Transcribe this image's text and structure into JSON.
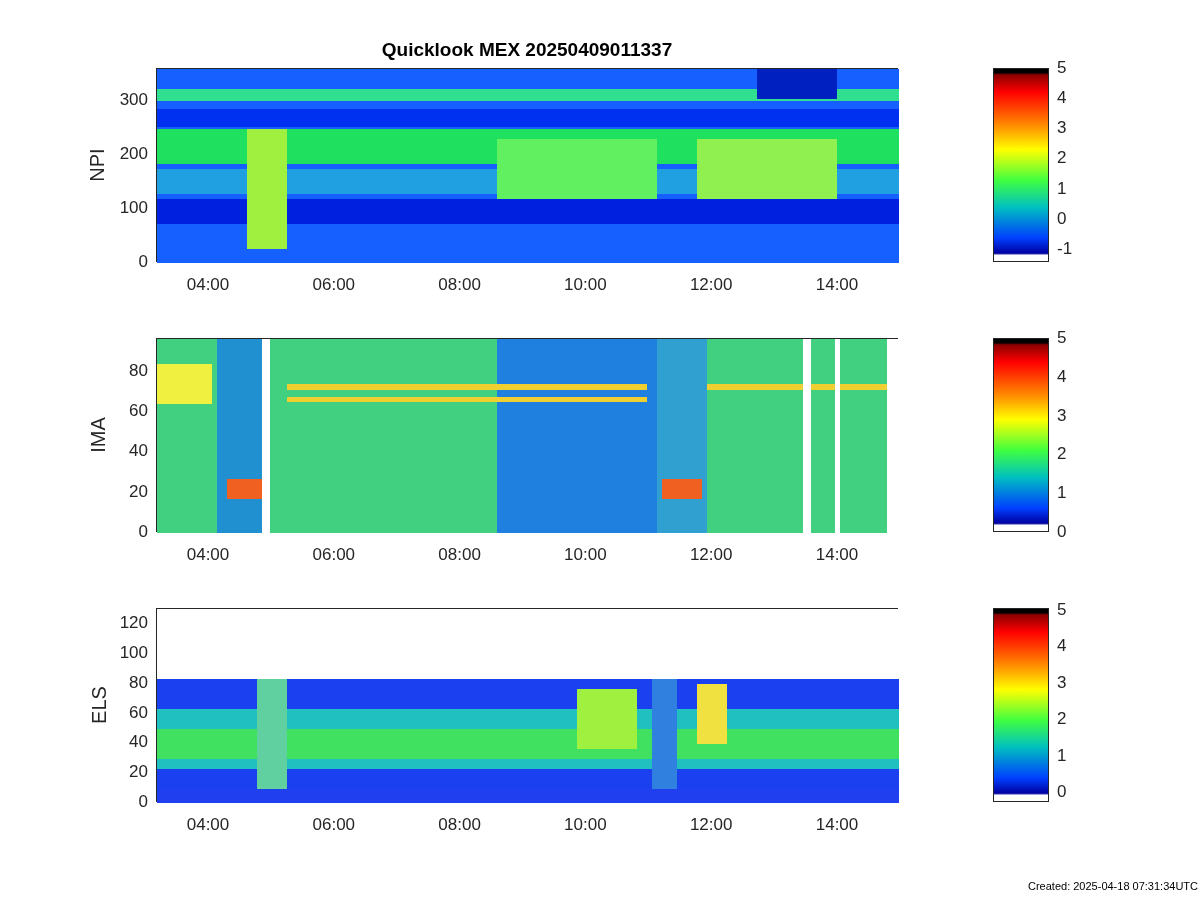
{
  "title": "Quicklook MEX 20250409011337",
  "panels": [
    {
      "kind": "npi",
      "ylabel": "NPI",
      "yticks": [
        "300",
        "200",
        "100",
        "0"
      ],
      "xticks": [
        "04:00",
        "06:00",
        "08:00",
        "10:00",
        "12:00",
        "14:00"
      ],
      "colorbar_ticks": [
        "5",
        "4",
        "3",
        "2",
        "1",
        "0",
        "-1"
      ]
    },
    {
      "kind": "ima",
      "ylabel": "IMA",
      "yticks": [
        "80",
        "60",
        "40",
        "20",
        "0"
      ],
      "xticks": [
        "04:00",
        "06:00",
        "08:00",
        "10:00",
        "12:00",
        "14:00"
      ],
      "colorbar_ticks": [
        "5",
        "4",
        "3",
        "2",
        "1",
        "0"
      ]
    },
    {
      "kind": "els",
      "ylabel": "ELS",
      "yticks": [
        "120",
        "100",
        "80",
        "60",
        "40",
        "20",
        "0"
      ],
      "xticks": [
        "04:00",
        "06:00",
        "08:00",
        "10:00",
        "12:00",
        "14:00"
      ],
      "colorbar_ticks": [
        "5",
        "4",
        "3",
        "2",
        "1",
        "0"
      ]
    }
  ],
  "footer": "Created: 2025-04-18 07:31:34UTC"
}
